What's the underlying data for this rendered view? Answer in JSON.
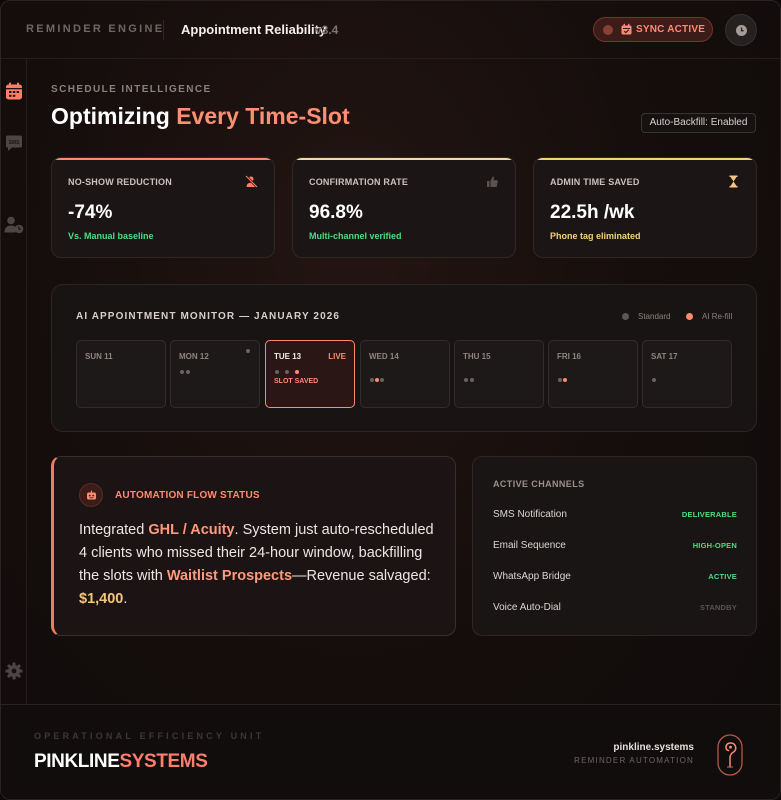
{
  "topbar": {
    "brand": "REMINDER ENGINE",
    "app_title": "Appointment Reliability",
    "version": "v3.4",
    "sync_label": "SYNC ACTIVE"
  },
  "sidebar": {
    "items": [
      {
        "icon": "calendar-icon",
        "active": true
      },
      {
        "icon": "sms-icon",
        "active": false
      },
      {
        "icon": "user-clock-icon",
        "active": false
      },
      {
        "icon": "gear-icon",
        "active": false
      }
    ]
  },
  "header": {
    "eyebrow": "SCHEDULE INTELLIGENCE",
    "title_main": "Optimizing",
    "title_accent": "Every Time-Slot",
    "backfill_badge": "Auto-Backfill: Enabled"
  },
  "stats": [
    {
      "label": "NO-SHOW REDUCTION",
      "value": "-74%",
      "sub": "Vs. Manual baseline",
      "icon": "user-slash-icon",
      "accent": "#ff8a70",
      "sub_color": "#4ade80"
    },
    {
      "label": "CONFIRMATION RATE",
      "value": "96.8%",
      "sub": "Multi-channel verified",
      "icon": "thumbs-up-icon",
      "accent": "#f3d9a8",
      "sub_color": "#4ade80"
    },
    {
      "label": "ADMIN TIME SAVED",
      "value": "22.5h /wk",
      "sub": "Phone tag eliminated",
      "icon": "hourglass-icon",
      "accent": "#f5d27a",
      "sub_color": "#f5d27a"
    }
  ],
  "monitor": {
    "title": "AI APPOINTMENT MONITOR — JANUARY 2026",
    "legend": [
      {
        "label": "Standard",
        "color": "#5d5654"
      },
      {
        "label": "AI Re-fill",
        "color": "#ff8a70"
      }
    ],
    "live_tag": "LIVE",
    "slot_saved": "SLOT SAVED",
    "days": [
      {
        "label": "SUN 11",
        "dots": []
      },
      {
        "label": "MON 12",
        "dots": [
          "s",
          "s"
        ]
      },
      {
        "label": "TUE 13",
        "dots": [
          "s",
          "s",
          "o"
        ],
        "live": true
      },
      {
        "label": "WED 14",
        "dots": [
          "s",
          "o",
          "s"
        ]
      },
      {
        "label": "THU 15",
        "dots": [
          "s",
          "s"
        ]
      },
      {
        "label": "FRI 16",
        "dots": [
          "s",
          "o"
        ]
      },
      {
        "label": "SAT 17",
        "dots": [
          "s"
        ]
      }
    ]
  },
  "automation": {
    "title": "AUTOMATION FLOW STATUS",
    "t1": "Integrated ",
    "h1": "GHL / Acuity",
    "t2": ". System just auto-rescheduled 4 clients who missed their 24-hour window, backfilling the slots with ",
    "h2": "Waitlist Prospects",
    "t3": "—Revenue salvaged: ",
    "h3": "$1,400",
    "t4": "."
  },
  "channels": {
    "title": "ACTIVE CHANNELS",
    "items": [
      {
        "name": "SMS Notification",
        "status": "DELIVERABLE",
        "color": "#4ade80"
      },
      {
        "name": "Email Sequence",
        "status": "HIGH-OPEN",
        "color": "#4ade80"
      },
      {
        "name": "WhatsApp Bridge",
        "status": "ACTIVE",
        "color": "#4ade80"
      },
      {
        "name": "Voice Auto-Dial",
        "status": "STANDBY",
        "color": "#5a5250"
      }
    ]
  },
  "footer": {
    "eyebrow": "OPERATIONAL EFFICIENCY UNIT",
    "logo_white": "PINKLINE",
    "logo_pink": "SYSTEMS",
    "site": "pinkline.systems",
    "subtitle": "REMINDER AUTOMATION"
  }
}
